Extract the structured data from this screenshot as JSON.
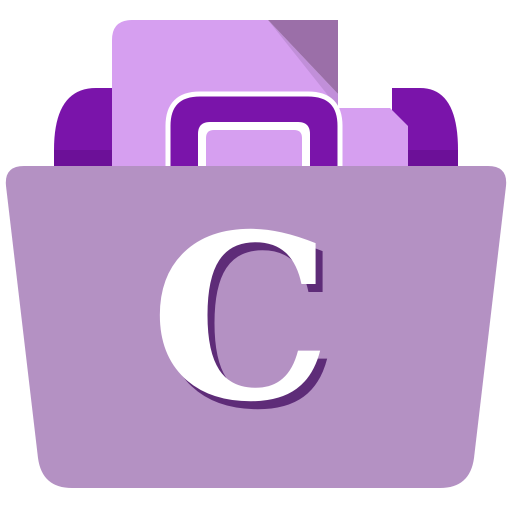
{
  "app_icon": {
    "name": "folder app icon",
    "letter": "C",
    "icon_names": [
      "folder-icon",
      "document-icon",
      "handle-icon"
    ],
    "colors": {
      "background": "#ffffff",
      "folder_back": "#7a14aa",
      "folder_back_shade": "#5e0c86",
      "document": "#d69ff0",
      "document_fold": "#9b6fa8",
      "handle_outer": "#7a14aa",
      "handle_inner": "#ffffff",
      "folder_front": "#b491c3",
      "letter_fill": "#ffffff",
      "letter_shadow": "#5e2c78"
    }
  }
}
